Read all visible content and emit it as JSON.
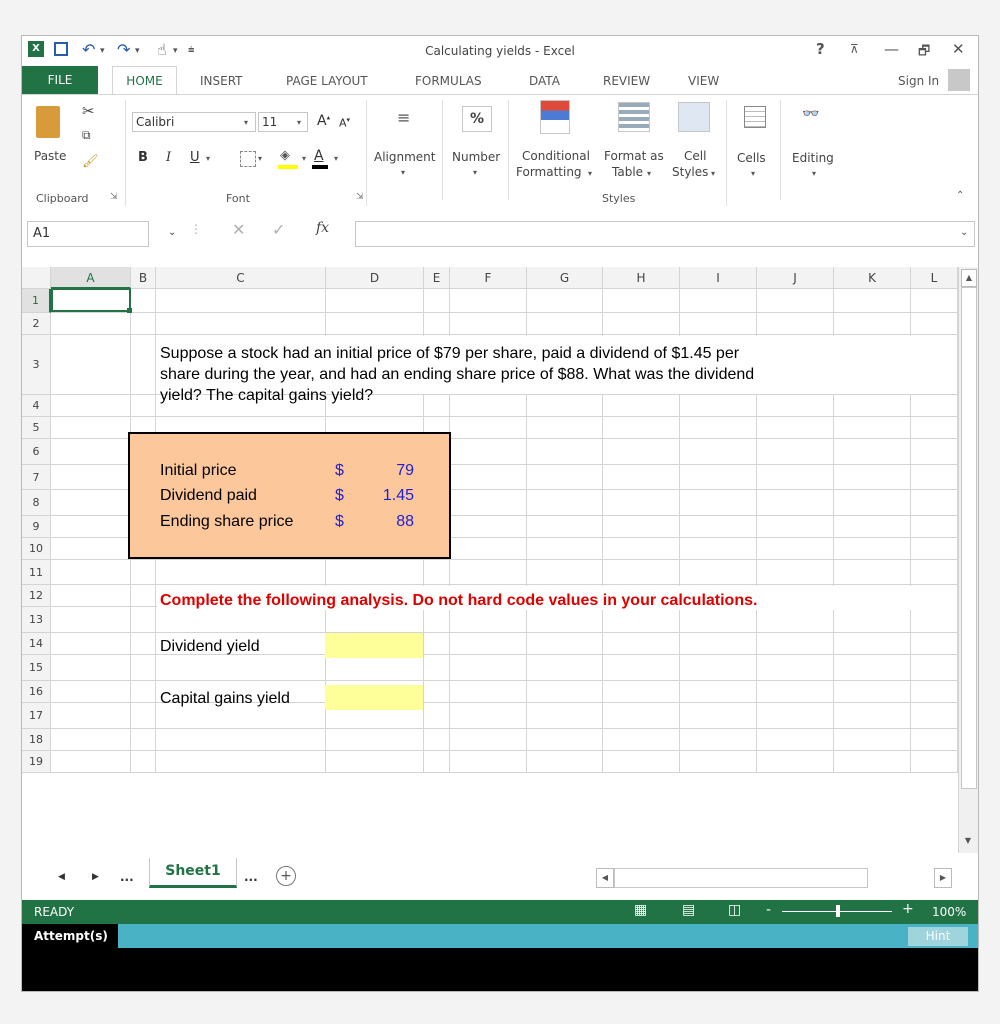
{
  "window": {
    "title": "Calculating yields - Excel"
  },
  "titlebar": {
    "help": "?",
    "restore_ribbon": "⊼",
    "minimize": "—",
    "maximize": "🗗",
    "close": "✕"
  },
  "tabs": {
    "file": "FILE",
    "home": "HOME",
    "insert": "INSERT",
    "page_layout": "PAGE LAYOUT",
    "formulas": "FORMULAS",
    "data": "DATA",
    "review": "REVIEW",
    "view": "VIEW",
    "sign_in": "Sign In"
  },
  "ribbon": {
    "paste": "Paste",
    "clipboard": "Clipboard",
    "font_name": "Calibri",
    "font_size": "11",
    "font_group": "Font",
    "bold": "B",
    "italic": "I",
    "underline": "U",
    "alignment": "Alignment",
    "number": "Number",
    "conditional_formatting_1": "Conditional",
    "conditional_formatting_2": "Formatting",
    "format_as_table_1": "Format as",
    "format_as_table_2": "Table",
    "cell_styles_1": "Cell",
    "cell_styles_2": "Styles",
    "styles_group": "Styles",
    "cells": "Cells",
    "editing": "Editing"
  },
  "formula_bar": {
    "name_box": "A1",
    "fx": "fx",
    "formula": ""
  },
  "columns": [
    "A",
    "B",
    "C",
    "D",
    "E",
    "F",
    "G",
    "H",
    "I",
    "J",
    "K",
    "L"
  ],
  "rows": [
    "1",
    "2",
    "3",
    "4",
    "5",
    "6",
    "7",
    "8",
    "9",
    "10",
    "11",
    "12",
    "13",
    "14",
    "15",
    "16",
    "17",
    "18",
    "19"
  ],
  "cells": {
    "question_line1": "Suppose a stock had an initial price of $79 per share, paid a dividend of $1.45 per",
    "question_line2": "share during the year, and had an ending share price of $88. What was the dividend",
    "question_line3": "yield? The capital gains yield?",
    "initial_price_label": "Initial price",
    "initial_price_currency": "$",
    "initial_price_value": "79",
    "dividend_paid_label": "Dividend paid",
    "dividend_paid_currency": "$",
    "dividend_paid_value": "1.45",
    "ending_price_label": "Ending share price",
    "ending_price_currency": "$",
    "ending_price_value": "88",
    "instruction": "Complete the following analysis. Do not hard code values in your calculations.",
    "dividend_yield_label": "Dividend yield",
    "capital_gains_label": "Capital gains yield"
  },
  "sheets": {
    "more_left": "...",
    "active": "Sheet1",
    "more_right": "...",
    "add": "+"
  },
  "status": {
    "ready": "READY",
    "zoom": "100%"
  },
  "attempts": {
    "label": "Attempt(s)",
    "hint": "Hint"
  },
  "colors": {
    "excel_green": "#217346",
    "input_yellow": "#ffff99",
    "box_orange": "#fcc89b",
    "value_blue": "#1f1fd6",
    "instruction_red": "#e00000",
    "attempt_bar": "#49b3c5"
  }
}
